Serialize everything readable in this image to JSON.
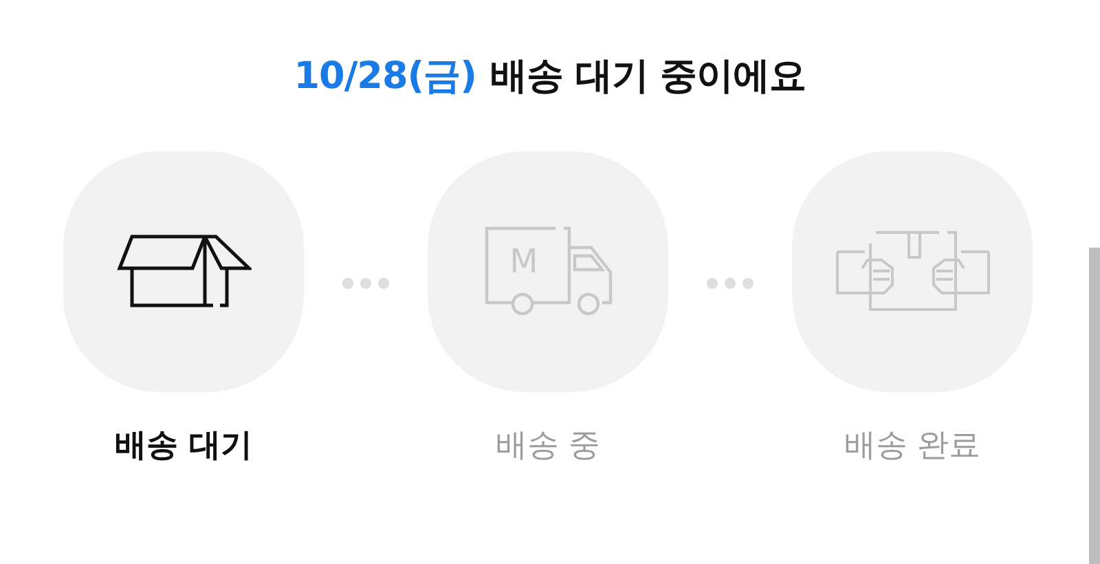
{
  "header": {
    "date": "10/28(금)",
    "text": "배송 대기 중이에요"
  },
  "steps": [
    {
      "kind": "box",
      "label": "배송 대기",
      "selected": true
    },
    {
      "kind": "truck",
      "label": "배송 중",
      "selected": false,
      "icon_letter": "M"
    },
    {
      "kind": "handover",
      "label": "배송 완료",
      "selected": false
    }
  ]
}
